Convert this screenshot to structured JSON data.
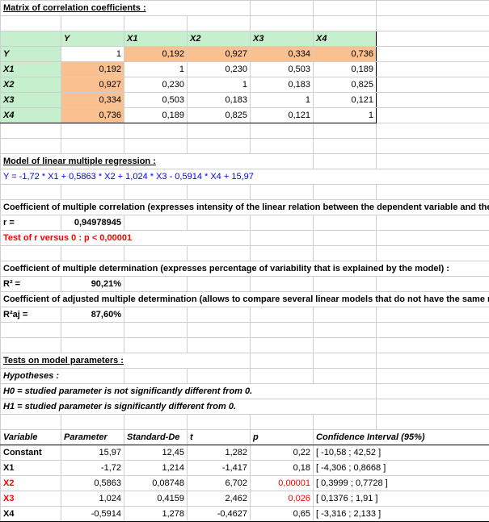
{
  "title": "Matrix of correlation coefficients :",
  "corr": {
    "headers": [
      "Y",
      "X1",
      "X2",
      "X3",
      "X4"
    ],
    "rows": [
      {
        "name": "Y",
        "vals": [
          "1",
          "0,192",
          "0,927",
          "0,334",
          "0,736"
        ]
      },
      {
        "name": "X1",
        "vals": [
          "0,192",
          "1",
          "0,230",
          "0,503",
          "0,189"
        ]
      },
      {
        "name": "X2",
        "vals": [
          "0,927",
          "0,230",
          "1",
          "0,183",
          "0,825"
        ]
      },
      {
        "name": "X3",
        "vals": [
          "0,334",
          "0,503",
          "0,183",
          "1",
          "0,121"
        ]
      },
      {
        "name": "X4",
        "vals": [
          "0,736",
          "0,189",
          "0,825",
          "0,121",
          "1"
        ]
      }
    ]
  },
  "model_title": "Model of linear multiple regression :",
  "model_eq": "Y = -1,72 * X1  + 0,5863 * X2 + 1,024 * X3 - 0,5914 * X4 + 15,97",
  "coef_mult_corr_title": "Coefficient of multiple correlation (expresses intensity of the linear relation between the dependent variable and the independent variables) :",
  "r_label": "r =",
  "r_val": "0,94978945",
  "test_r": "Test of r versus 0 : p < 0,00001",
  "coef_mult_det_title": "Coefficient of multiple determination (expresses percentage of variability that is explained by the model) :",
  "r2_label": "R² =",
  "r2_val": "90,21%",
  "coef_adj_title": "Coefficient of adjusted multiple determination (allows to compare several linear models that do not have the same number of parameters) :",
  "r2aj_label": "R²aj =",
  "r2aj_val": "87,60%",
  "tests_title": "Tests on model parameters :",
  "hyp_label": "Hypotheses :",
  "h0": "H0 = studied parameter is not significantly different from 0.",
  "h1": "H1 = studied parameter is significantly different from 0.",
  "param_headers": [
    "Variable",
    "Parameter",
    "Standard-De",
    "t",
    "p",
    "Confidence Interval (95%)"
  ],
  "params": [
    {
      "var": "Constant",
      "param": "15,97",
      "sd": "12,45",
      "t": "1,282",
      "p": "0,22",
      "ci": "[ -10,58 ; 42,52 ]",
      "red": false
    },
    {
      "var": "X1",
      "param": "-1,72",
      "sd": "1,214",
      "t": "-1,417",
      "p": "0,18",
      "ci": "[ -4,306 ; 0,8668 ]",
      "red": false
    },
    {
      "var": "X2",
      "param": "0,5863",
      "sd": "0,08748",
      "t": "6,702",
      "p": "0,00001",
      "ci": "[ 0,3999 ; 0,7728 ]",
      "red": true
    },
    {
      "var": "X3",
      "param": "1,024",
      "sd": "0,4159",
      "t": "2,462",
      "p": "0,026",
      "ci": "[ 0,1376 ; 1,91 ]",
      "red": true
    },
    {
      "var": "X4",
      "param": "-0,5914",
      "sd": "1,278",
      "t": "-0,4627",
      "p": "0,65",
      "ci": "[ -3,316 ; 2,133 ]",
      "red": false
    }
  ]
}
